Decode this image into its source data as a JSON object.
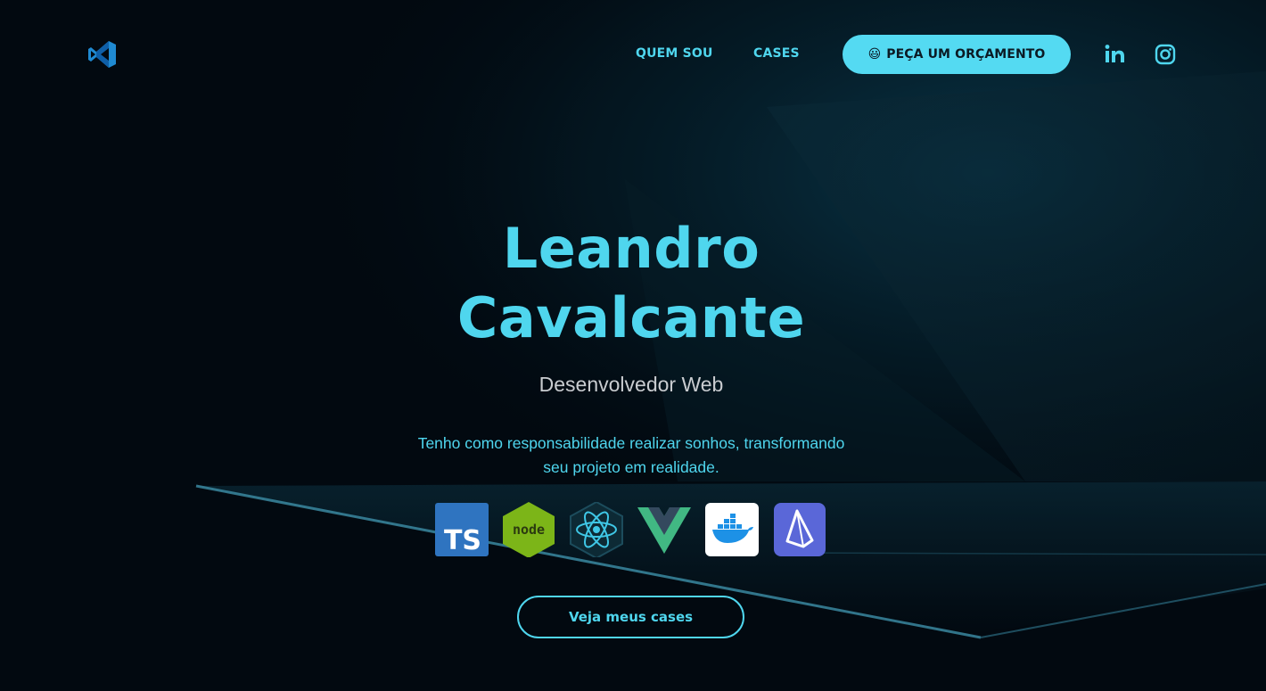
{
  "nav": {
    "logo_icon": "vscode-logo-icon",
    "links": [
      {
        "label": "QUEM SOU"
      },
      {
        "label": "CASES"
      }
    ],
    "cta": {
      "emoji": "😃",
      "label": "PEÇA UM ORÇAMENTO"
    },
    "social": [
      {
        "icon": "linkedin-icon"
      },
      {
        "icon": "instagram-icon"
      }
    ]
  },
  "hero": {
    "name_line1": "Leandro",
    "name_line2": "Cavalcante",
    "role": "Desenvolvedor Web",
    "tagline_line1": "Tenho como responsabilidade realizar sonhos, transformando",
    "tagline_line2": "seu projeto em realidade.",
    "tech_icons": [
      "typescript-icon",
      "nodejs-icon",
      "react-icon",
      "vue-icon",
      "docker-icon",
      "prisma-icon"
    ],
    "cta_secondary": "Veja meus cases"
  },
  "colors": {
    "accent": "#4fd6ee",
    "background": "#020910",
    "cta_bg": "#54daf2",
    "muted_text": "#c9ccd0"
  }
}
